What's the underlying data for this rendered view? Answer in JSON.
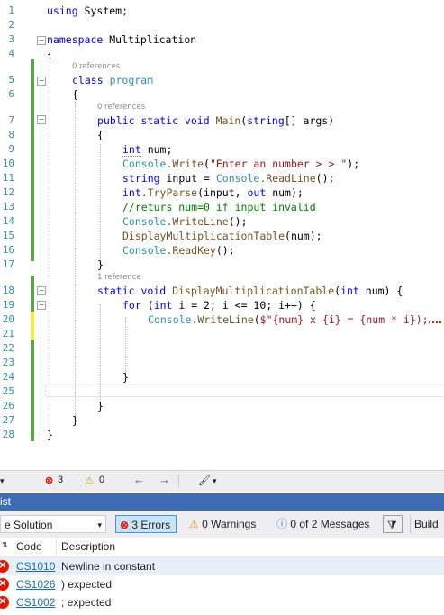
{
  "editor": {
    "line_numbers": [
      "1",
      "2",
      "3",
      "4",
      "5",
      "6",
      "7",
      "8",
      "9",
      "10",
      "11",
      "12",
      "13",
      "14",
      "15",
      "16",
      "17",
      "18",
      "19",
      "20",
      "21",
      "22",
      "23",
      "24",
      "25",
      "26",
      "27",
      "28"
    ],
    "code": {
      "l1_kw": "using",
      "l1_rest": " System;",
      "l3_kw": "namespace",
      "l3_rest": " Multiplication",
      "l4": "{",
      "ref0a": "0 references",
      "l5_kw": "class",
      "l5_name": "program",
      "l6": "{",
      "ref0b": "0 references",
      "l7_kw1": "public static void",
      "l7_m": "Main",
      "l7_p1": "(",
      "l7_t": "string",
      "l7_p2": "[] args)",
      "l8": "{",
      "l9_kw": "int",
      "l9_rest": " num;",
      "l10_t": "Console",
      "l10_m": ".Write",
      "l10_p1": "(",
      "l10_s": "\"Enter an number > > \"",
      "l10_p2": ");",
      "l11_kw": "string",
      "l11_a": " input = ",
      "l11_t": "Console",
      "l11_m": ".ReadLine",
      "l11_b": "();",
      "l12_kw": "int",
      "l12_m": ".TryParse",
      "l12_a": "(input, ",
      "l12_kw2": "out",
      "l12_b": " num);",
      "l13": "//returs num=0 if input invalid",
      "l14_t": "Console",
      "l14_m": ".WriteLine",
      "l14_b": "();",
      "l15_m": "DisplayMultiplicationTable",
      "l15_b": "(num);",
      "l16_t": "Console",
      "l16_m": ".ReadKey",
      "l16_b": "();",
      "l17": "}",
      "ref1": "1 reference",
      "l18_kw": "static void",
      "l18_m": "DisplayMultiplicationTable",
      "l18_a": "(",
      "l18_kw2": "int",
      "l18_b": " num) {",
      "l19_kw": "for",
      "l19_a": " (",
      "l19_kw2": "int",
      "l19_b": " i = 2; i <= 10; i++) {",
      "l20_t": "Console",
      "l20_m": ".WriteLine",
      "l20_a": "(",
      "l20_s": "$\"{num} x {i} = {num * i});",
      "l24": "}",
      "l26": "}",
      "l27": "}",
      "l28": "}"
    }
  },
  "statusbar": {
    "errors": "3",
    "warnings": "0",
    "nav_back": "←",
    "nav_forward": "→"
  },
  "error_list": {
    "title": "ist",
    "scope": "e Solution",
    "errors_btn": "3 Errors",
    "warnings_btn": "0 Warnings",
    "messages_btn": "0 of 2 Messages",
    "build_label": "Build",
    "col_code": "Code",
    "col_desc": "Description",
    "rows": [
      {
        "code": "CS1010",
        "desc": "Newline in constant"
      },
      {
        "code": "CS1026",
        "desc": ") expected"
      },
      {
        "code": "CS1002",
        "desc": "; expected"
      }
    ]
  },
  "colors": {
    "keyword": "#0000ff",
    "type": "#2b91af",
    "string": "#a31515",
    "comment": "#008000",
    "error": "#e51400",
    "panel_title_bg": "#3e6db5"
  }
}
